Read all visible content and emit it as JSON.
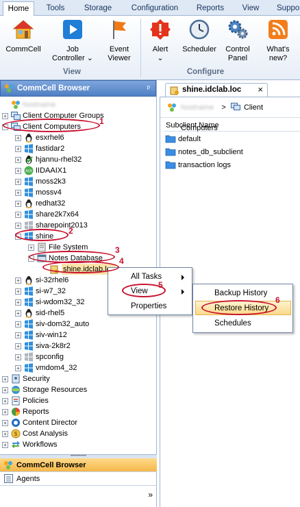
{
  "ribbon": {
    "tabs": [
      "Home",
      "Tools",
      "Storage",
      "Configuration",
      "Reports",
      "View",
      "Suppo"
    ],
    "buttons": {
      "commcell": "CommCell",
      "job_controller_1": "Job",
      "job_controller_2": "Controller",
      "job_controller_caret": "⌄",
      "event_viewer_1": "Event",
      "event_viewer_2": "Viewer",
      "alert": "Alert",
      "alert_caret": "⌄",
      "scheduler": "Scheduler",
      "control_panel_1": "Control",
      "control_panel_2": "Panel",
      "whats_new_1": "What's",
      "whats_new_2": "new?"
    },
    "groups": {
      "view": "View",
      "configure": "Configure"
    }
  },
  "left_panel": {
    "title": "CommCell Browser",
    "pin": "ᵖ",
    "tree": {
      "root": "hostname",
      "client_computer_groups": "Client Computer Groups",
      "client_computers": "Client Computers",
      "clients": [
        "esxrhel6",
        "fastidar2",
        "hjannu-rhel32",
        "IIDAAIX1",
        "moss2k3",
        "mossv4",
        "redhat32",
        "share2k7x64",
        "sharepoint2013",
        "shine"
      ],
      "file_system": "File System",
      "notes_database": "Notes Database",
      "shine_idclab": "shine.idclab.loc",
      "clients_after": [
        "si-32rhel6",
        "si-w7_32",
        "si-wdom32_32",
        "sid-rhel5",
        "siv-dom32_auto",
        "siv-win12",
        "siva-2k8r2",
        "spconfig",
        "vmdom4_32"
      ],
      "top_level": [
        "Security",
        "Storage Resources",
        "Policies",
        "Reports",
        "Content Director",
        "Cost Analysis",
        "Workflows"
      ]
    },
    "bottom_tabs": [
      "CommCell Browser",
      "Agents"
    ],
    "overflow": "»"
  },
  "right_panel": {
    "tab_title": "shine.idclab.loc",
    "tab_close": "×",
    "breadcrumb_root": "hostname",
    "breadcrumb_sep": ">",
    "breadcrumb_item": "Client Computers",
    "column_header": "Subclient Name",
    "subclients": [
      "default",
      "notes_db_subclient",
      "transaction logs"
    ]
  },
  "context_menu": {
    "items": [
      "All Tasks",
      "View",
      "Properties"
    ],
    "submenu": [
      "Backup History",
      "Restore History",
      "Schedules"
    ]
  },
  "annotations": [
    "1",
    "2",
    "3",
    "4",
    "5",
    "6"
  ],
  "colors": {
    "accent": "#4f7fc4",
    "annotation": "#c8102e",
    "folder": "#3a8ee6"
  }
}
